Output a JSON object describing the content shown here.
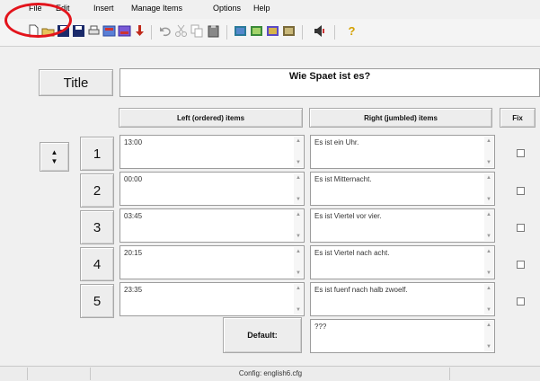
{
  "menu": {
    "items": [
      {
        "name": "menu-file",
        "label": "File"
      },
      {
        "name": "menu-edit",
        "label": "Edit"
      },
      {
        "name": "menu-insert",
        "label": "Insert"
      },
      {
        "name": "menu-manage-items",
        "label": "Manage Items"
      },
      {
        "name": "menu-options",
        "label": "Options"
      },
      {
        "name": "menu-help",
        "label": "Help"
      }
    ]
  },
  "toolbar": {
    "icons": [
      "new-document-icon",
      "open-folder-icon",
      "save-icon",
      "save-as-icon",
      "print-icon",
      "export-icon",
      "export-alt-icon",
      "download-arrow-icon",
      "undo-icon",
      "cut-icon",
      "copy-icon",
      "paste-icon",
      "game-icon-1",
      "game-icon-2",
      "game-icon-3",
      "game-icon-4",
      "speaker-icon",
      "help-icon"
    ],
    "help_glyph": "?"
  },
  "title_section": {
    "title_button_label": "Title",
    "title_value": "Wie Spaet ist es?"
  },
  "table": {
    "left_header": "Left (ordered) items",
    "right_header": "Right (jumbled) items",
    "fix_header": "Fix",
    "rows": [
      {
        "number": "1",
        "left": "13:00",
        "right": "Es ist ein Uhr."
      },
      {
        "number": "2",
        "left": "00:00",
        "right": "Es ist Mitternacht."
      },
      {
        "number": "3",
        "left": "03:45",
        "right": "Es ist Viertel vor vier."
      },
      {
        "number": "4",
        "left": "20:15",
        "right": "Es ist Viertel nach acht."
      },
      {
        "number": "5",
        "left": "23:35",
        "right": "Es ist fuenf nach halb zwoelf."
      }
    ],
    "default_label": "Default:",
    "default_value": "???"
  },
  "spinner": {
    "up": "▲",
    "down": "▼"
  },
  "scroll_glyphs": {
    "up": "▲",
    "down": "▼"
  },
  "status": {
    "config": "Config: english6.cfg"
  },
  "colors": {
    "highlight": "#e3141c",
    "background": "#f0f0f0"
  }
}
